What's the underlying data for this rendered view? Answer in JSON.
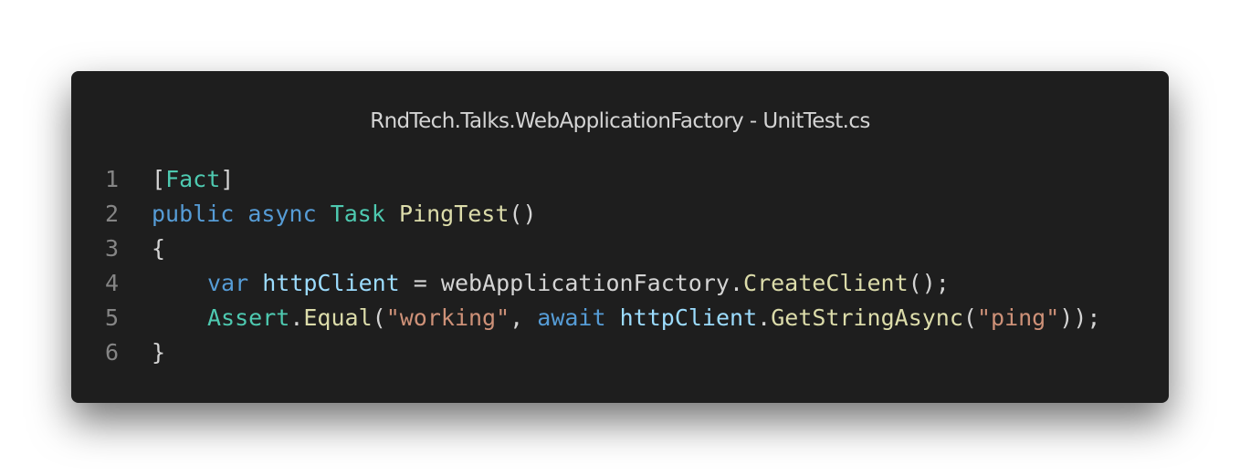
{
  "window": {
    "title": "RndTech.Talks.WebApplicationFactory - UnitTest.cs"
  },
  "colors": {
    "background": "#1e1e1e",
    "keyword": "#569cd6",
    "type": "#4ec9b0",
    "function": "#dcdcaa",
    "variable": "#9cdcfe",
    "string": "#ce9178",
    "line_number": "#858585"
  },
  "code": {
    "line_numbers": [
      "1",
      "2",
      "3",
      "4",
      "5",
      "6"
    ],
    "l1": {
      "open": "[",
      "attr": "Fact",
      "close": "]"
    },
    "l2": {
      "public": "public",
      "async": "async",
      "task": "Task",
      "method": "PingTest",
      "parens": "()"
    },
    "l3": {
      "brace": "{"
    },
    "l4": {
      "var": "var",
      "name": "httpClient",
      "assign": " = webApplicationFactory.",
      "method": "CreateClient",
      "tail": "();"
    },
    "l5": {
      "cls": "Assert",
      "dot": ".",
      "method": "Equal",
      "open": "(",
      "str1": "\"working\"",
      "comma": ", ",
      "await": "await",
      "obj": "httpClient",
      "dot2": ".",
      "method2": "GetStringAsync",
      "open2": "(",
      "str2": "\"ping\"",
      "close": "));"
    },
    "l6": {
      "brace": "}"
    }
  }
}
